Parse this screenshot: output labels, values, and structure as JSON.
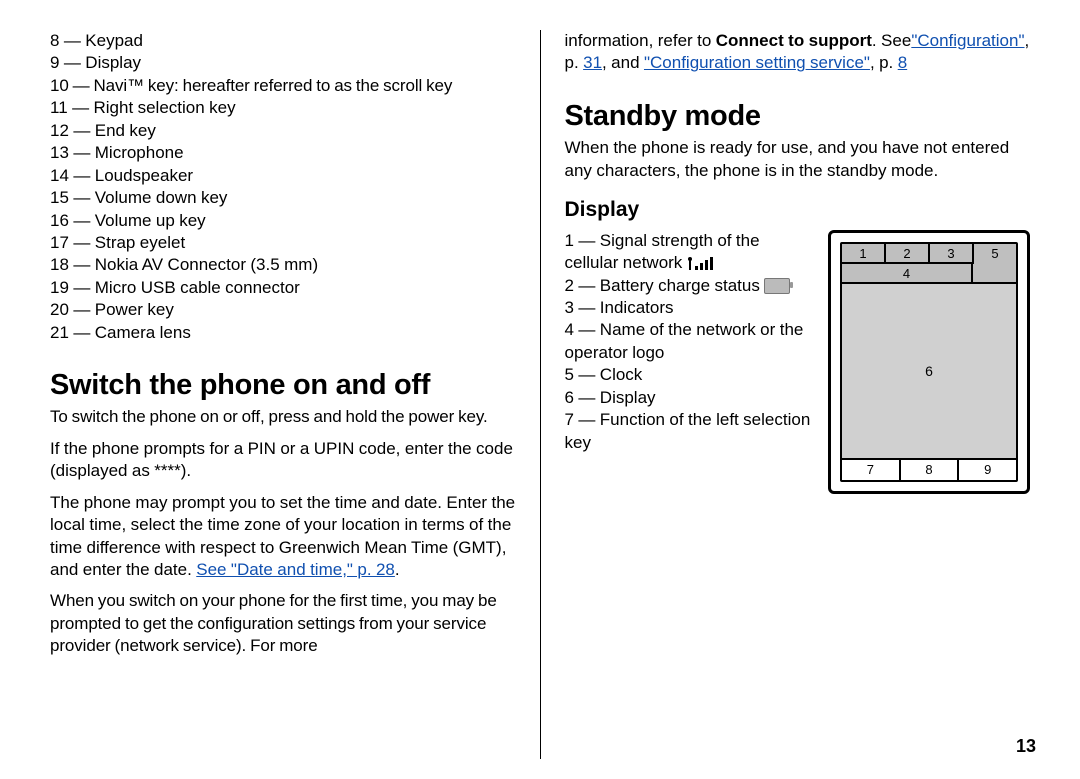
{
  "page_number": "13",
  "left": {
    "parts": [
      "8 — Keypad",
      "9 — Display",
      "10 — Navi™ key: hereafter referred to as the scroll key",
      "11 — Right selection key",
      "12 — End key",
      "13 — Microphone",
      "14 — Loudspeaker",
      "15 — Volume down key",
      "16 — Volume up key",
      "17 — Strap eyelet",
      "18 — Nokia AV Connector (3.5 mm)",
      "19 — Micro USB cable connector",
      "20 — Power key",
      "21 — Camera lens"
    ],
    "h1": "Switch the phone on and off",
    "p1": "To switch the phone on or off, press and hold the power key.",
    "p2": "If the phone prompts for a PIN or a UPIN code, enter the code (displayed as ****).",
    "p3_a": "The phone may prompt you to set the time and date. Enter the local time, select the time zone of your location in terms of the time difference with respect to Greenwich Mean Time (GMT), and enter the date. ",
    "p3_link": "See \"Date and time,\" p. 28",
    "p3_b": ".",
    "p4": "When you switch on your phone for the first time, you may be prompted to get the configuration settings from your service provider (network service). For more"
  },
  "right": {
    "cont_a": "information, refer to ",
    "cont_bold": "Connect to support",
    "cont_b": ". See",
    "link1": "\"Configuration\"",
    "mid1": ", p. ",
    "link1p": "31",
    "mid2": ", and ",
    "link2": "\"Configuration setting service\"",
    "mid3": ", p. ",
    "link2p": "8",
    "h1": "Standby mode",
    "p1": "When the phone is ready for use, and you have not entered any characters, the phone is in the standby mode.",
    "h2": "Display",
    "diagram": {
      "top": [
        "1",
        "2",
        "3"
      ],
      "top_right": "5",
      "row2": "4",
      "mid": "6",
      "bot": [
        "7",
        "8",
        "9"
      ]
    },
    "items_pre": [
      "1 — Signal strength of the cellular network ",
      "2 — Battery charge status "
    ],
    "items_rest": [
      "3 — Indicators",
      "4 — Name of the network or the operator logo",
      "5 — Clock",
      "6 — Display",
      "7 — Function of the left selection key"
    ]
  }
}
